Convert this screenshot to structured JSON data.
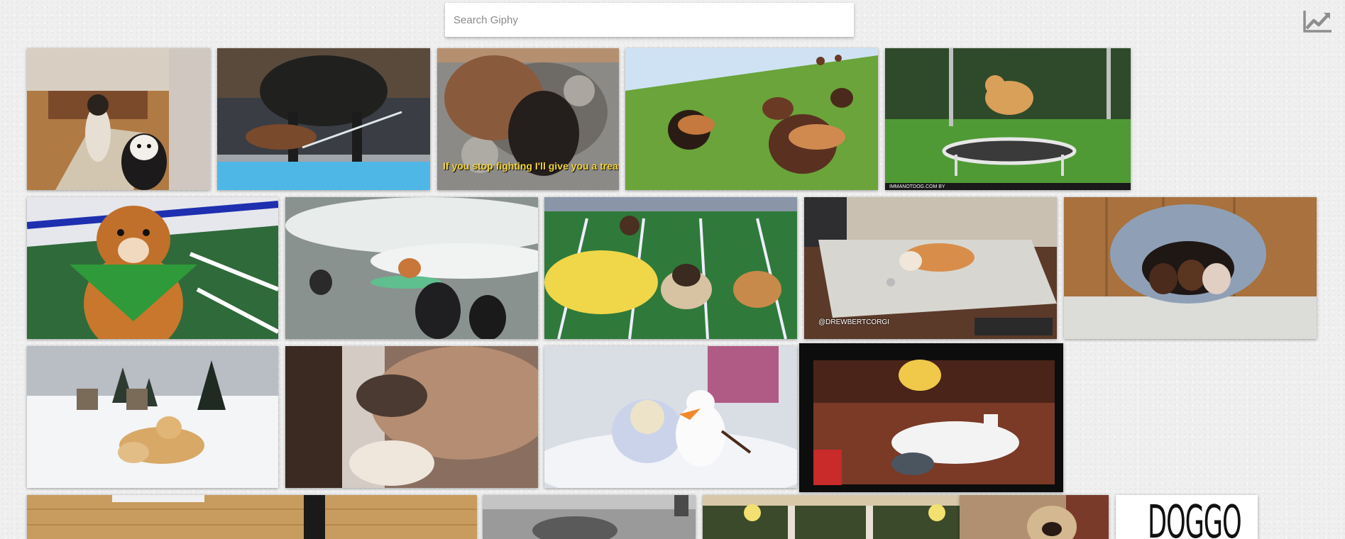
{
  "search": {
    "placeholder": "Search Giphy"
  },
  "trending": {
    "icon": "trending-up-icon"
  },
  "gifs": [
    {
      "subject": "two dogs sitting on stairs"
    },
    {
      "subject": "dog drinking from pool"
    },
    {
      "subject": "two dogs fighting on rug",
      "caption": "If you stop fighting I'll give you a treat"
    },
    {
      "subject": "dachshunds in hot dog costumes running"
    },
    {
      "subject": "shiba inu on trampoline",
      "watermark": "IMMANOTDOG.COM BY"
    },
    {
      "subject": "puppy with green bandana"
    },
    {
      "subject": "surfing corgi"
    },
    {
      "subject": "pugs on puppy bowl field"
    },
    {
      "subject": "corgi lying on rug",
      "watermark": "@DREWBERTCORGI"
    },
    {
      "subject": "puppies in dog bed"
    },
    {
      "subject": "golden puppies in snow"
    },
    {
      "subject": "dogs touching noses"
    },
    {
      "subject": "dog dressed as olaf"
    },
    {
      "subject": "cartoon dog rolling over"
    },
    {
      "subject": "dog legs on brick patio"
    },
    {
      "subject": "black and white dog"
    },
    {
      "subject": "dogs at party with balloons"
    },
    {
      "subject": "pug face"
    },
    {
      "subject": "doggo text",
      "text": "DOGGO"
    }
  ]
}
